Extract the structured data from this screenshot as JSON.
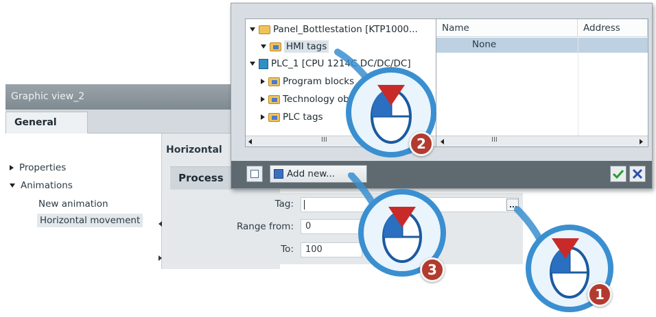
{
  "inspector": {
    "title": "Graphic view_2",
    "tab_general": "General",
    "tree": {
      "properties": "Properties",
      "animations": "Animations",
      "new_animation": "New animation",
      "horizontal_movement": "Horizontal movement"
    },
    "section_title": "Horizontal",
    "process_title": "Process"
  },
  "form": {
    "tag_label": "Tag:",
    "tag_value": "",
    "range_from_label": "Range from:",
    "range_from_value": "0",
    "to_label": "To:",
    "to_value": "100"
  },
  "popup": {
    "tree": {
      "panel": "Panel_Bottlestation [KTP1000...",
      "hmi_tags": "HMI tags",
      "plc": "PLC_1 [CPU 1214C DC/DC/DC]",
      "program": "Program blocks",
      "technology": "Technology objects",
      "plc_tags": "PLC tags",
      "scroll_thumb": "III"
    },
    "table": {
      "col_name": "Name",
      "col_address": "Address",
      "row_value": "None",
      "scroll_thumb": "III"
    },
    "add_new_label": "Add new..."
  },
  "callouts": {
    "step1": "1",
    "step2": "2",
    "step3": "3"
  },
  "colors": {
    "badge_red": "#b23a2f",
    "callout_blue": "#3a8fd0",
    "selection": "#bed1e3"
  }
}
